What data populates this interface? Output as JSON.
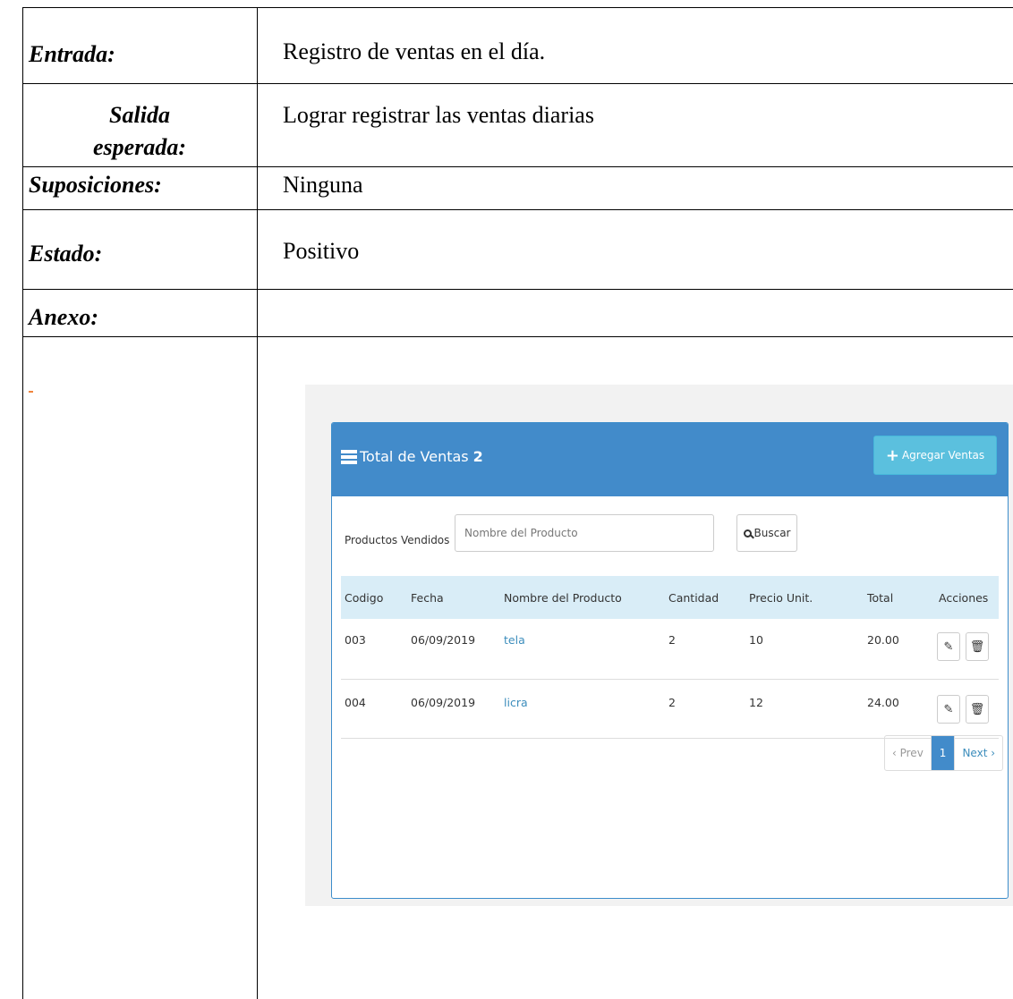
{
  "form": {
    "entrada_label": "Entrada:",
    "entrada_value": "Registro de ventas en el día.",
    "salida_label_line1": "Salida",
    "salida_label_line2": "esperada:",
    "salida_value": "Lograr registrar las ventas diarias",
    "suposiciones_label": "Suposiciones:",
    "suposiciones_value": "Ninguna",
    "estado_label": "Estado:",
    "estado_value": "Positivo",
    "anexo_label": "Anexo:"
  },
  "screenshot": {
    "panel_title": "Total de Ventas",
    "panel_count": "2",
    "add_button": "Agregar Ventas",
    "search_label": "Productos Vendidos",
    "search_placeholder": "Nombre del Producto",
    "search_button": "Buscar",
    "columns": {
      "codigo": "Codigo",
      "fecha": "Fecha",
      "producto": "Nombre del Producto",
      "cantidad": "Cantidad",
      "precio": "Precio Unit.",
      "total": "Total",
      "acciones": "Acciones"
    },
    "rows": [
      {
        "codigo": "003",
        "fecha": "06/09/2019",
        "producto": "tela",
        "cantidad": "2",
        "precio": "10",
        "total": "20.00"
      },
      {
        "codigo": "004",
        "fecha": "06/09/2019",
        "producto": "licra",
        "cantidad": "2",
        "precio": "12",
        "total": "24.00"
      }
    ],
    "pager": {
      "prev": "‹ Prev",
      "current": "1",
      "next": "Next ›"
    },
    "icons": {
      "title": "grid-icon",
      "add": "plus-icon",
      "search": "search-icon",
      "edit": "edit-icon",
      "delete": "trash-icon"
    },
    "colors": {
      "header": "#428bca",
      "add_button": "#5bc0de",
      "table_head": "#d9edf7",
      "link": "#3c8dbc"
    }
  }
}
